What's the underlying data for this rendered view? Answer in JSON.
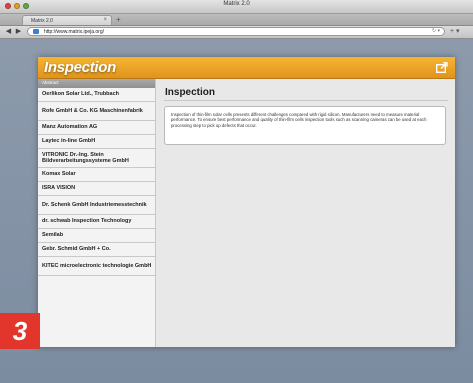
{
  "window": {
    "title": "Matrix 2.0"
  },
  "tab": {
    "label": "Matrix 2.0",
    "close": "×",
    "add": "+"
  },
  "navbar": {
    "back": "◀",
    "forward": "▶",
    "url": "http://www.matrix.ipeja.org/",
    "url_end": "↻ ▾",
    "right_icons": "+ ▾"
  },
  "header": {
    "title": "Inspection",
    "accent": "#f0a82a"
  },
  "sidebar": {
    "heading": "Abstract",
    "items": [
      {
        "label": "Oerlikon Solar Ltd., Trubbach"
      },
      {
        "label": "Rofe GmbH & Co. KG Maschinenfabrik"
      },
      {
        "label": "Manz Automation AG"
      },
      {
        "label": "Laytec in-line GmbH"
      },
      {
        "label": "VITRONIC Dr.-Ing. Stein Bildverarbeitungssysteme GmbH"
      },
      {
        "label": "Komax Solar"
      },
      {
        "label": "ISRA VISION"
      },
      {
        "label": "Dr. Schenk GmbH Industriemesstechnik"
      },
      {
        "label": "dr. schwab Inspection Technology"
      },
      {
        "label": "Semilab"
      },
      {
        "label": "Gebr. Schmid GmbH + Co."
      },
      {
        "label": "KITEC microelectronic technologie GmbH"
      }
    ]
  },
  "main": {
    "title": "Inspection",
    "body": "Inspection of thin-film solar cells presents different challenges compared with rigid silicon. Manufacturers need to measure material performance. To ensure best performance and quality of thin-film cells inspection tools such as scanning cameras can be used at each processing step to pick up defects that occur."
  },
  "badge": {
    "number": "3",
    "color": "#e2362c"
  }
}
